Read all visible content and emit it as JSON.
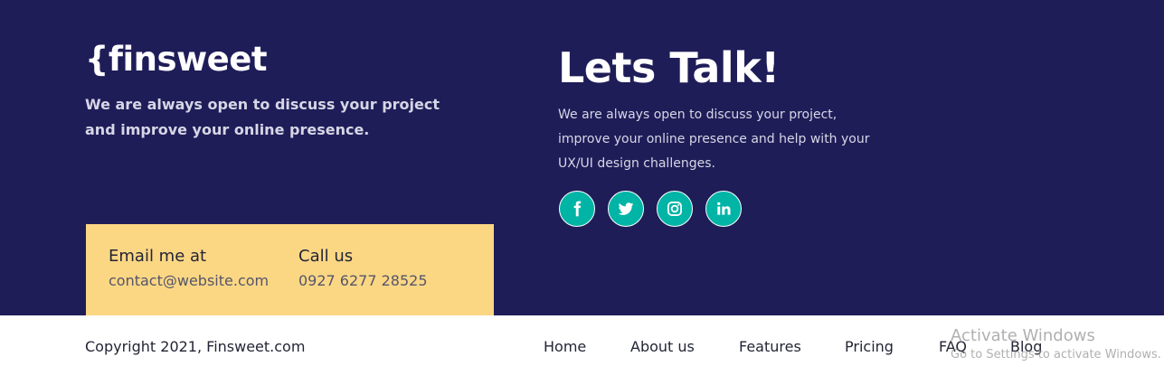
{
  "brand": {
    "logo": "{finsweet",
    "intro": "We are always open to discuss your project and improve your online presence."
  },
  "contact": {
    "email_heading": "Email me at",
    "email_value": "contact@website.com",
    "phone_heading": "Call us",
    "phone_value": "0927 6277 28525"
  },
  "talk": {
    "title": "Lets Talk!",
    "text": "We are always open to discuss your project, improve your online presence and help with your UX/UI design challenges."
  },
  "socials": [
    {
      "icon": "facebook-icon"
    },
    {
      "icon": "twitter-icon"
    },
    {
      "icon": "instagram-icon"
    },
    {
      "icon": "linkedin-icon"
    }
  ],
  "footer": {
    "copyright": "Copyright 2021, Finsweet.com",
    "nav": [
      "Home",
      "About us",
      "Features",
      "Pricing",
      "FAQ",
      "Blog"
    ]
  },
  "overlay": {
    "title": "Activate Windows",
    "subtitle": "Go to Settings to activate Windows."
  },
  "colors": {
    "navy": "#1f1d58",
    "yellow": "#fbd784",
    "teal": "#00b4a6",
    "dark_text": "#232536"
  }
}
